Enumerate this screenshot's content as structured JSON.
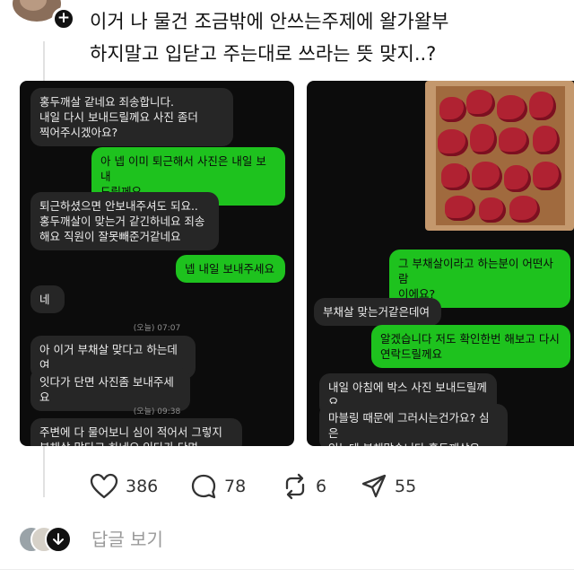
{
  "post": {
    "text_line1": "이거 나 물건 조금밖에 안쓰는주제에 왈가왈부",
    "text_line2": "하지말고 입닫고 주는대로 쓰라는 뜻 맞지..?"
  },
  "left_chat": {
    "messages": [
      {
        "side": "recv",
        "text": "홍두깨살 같네요 죄송합니다.\n내일 다시 보내드릴께요 사진 좀더\n찍어주시겠아요?"
      },
      {
        "side": "sent",
        "text": "아 넵 이미 퇴근해서 사진은 내일 보내\n드릴께요"
      },
      {
        "side": "recv",
        "text": "퇴근하셨으면 안보내주셔도 되요..\n홍두깨살이 맞는거 같긴하네요 죄송\n해요 직원이 잘못빼준거같네요"
      },
      {
        "side": "sent",
        "text": "넵 내일 보내주세요"
      },
      {
        "side": "recv",
        "text": "네"
      },
      {
        "side": "recv",
        "text": "아 이거 부채살 맞다고 하는데여"
      },
      {
        "side": "recv",
        "text": "잇다가 단면 사진좀 보내주세요"
      },
      {
        "side": "recv",
        "text": "주변에 다 물어보니 심이 적어서 그렇지\n부채살 맞다고 하네요 잇다가 단면"
      }
    ],
    "times": [
      "(오늘) 07:07",
      "(오늘) 09:38"
    ]
  },
  "right_chat": {
    "photo_alt": "meat-chunks-photo",
    "messages": [
      {
        "side": "sent",
        "text": "그 부채살이라고 하는분이 어떤사람\n이에요?"
      },
      {
        "side": "recv",
        "text": "부채살 맞는거같은데여"
      },
      {
        "side": "sent",
        "text": "알겠습니다 저도 확인한번 해보고 다시\n연락드릴께요"
      },
      {
        "side": "recv",
        "text": "내일 아침에 박스 사진 보내드릴께요"
      },
      {
        "side": "recv",
        "text": "마블링 때문에 그러시는건가요? 심은\n있는데 부채맞습니다 홍두깨살은\n가운데 심이 없습니다."
      }
    ]
  },
  "actions": {
    "likes": "386",
    "comments": "78",
    "reposts": "6",
    "shares": "55"
  },
  "replies": {
    "label": "답글 보기"
  },
  "colors": {
    "sent_bubble": "#1ec21e",
    "recv_bubble": "#262626",
    "chat_bg": "#0c0c0c"
  }
}
